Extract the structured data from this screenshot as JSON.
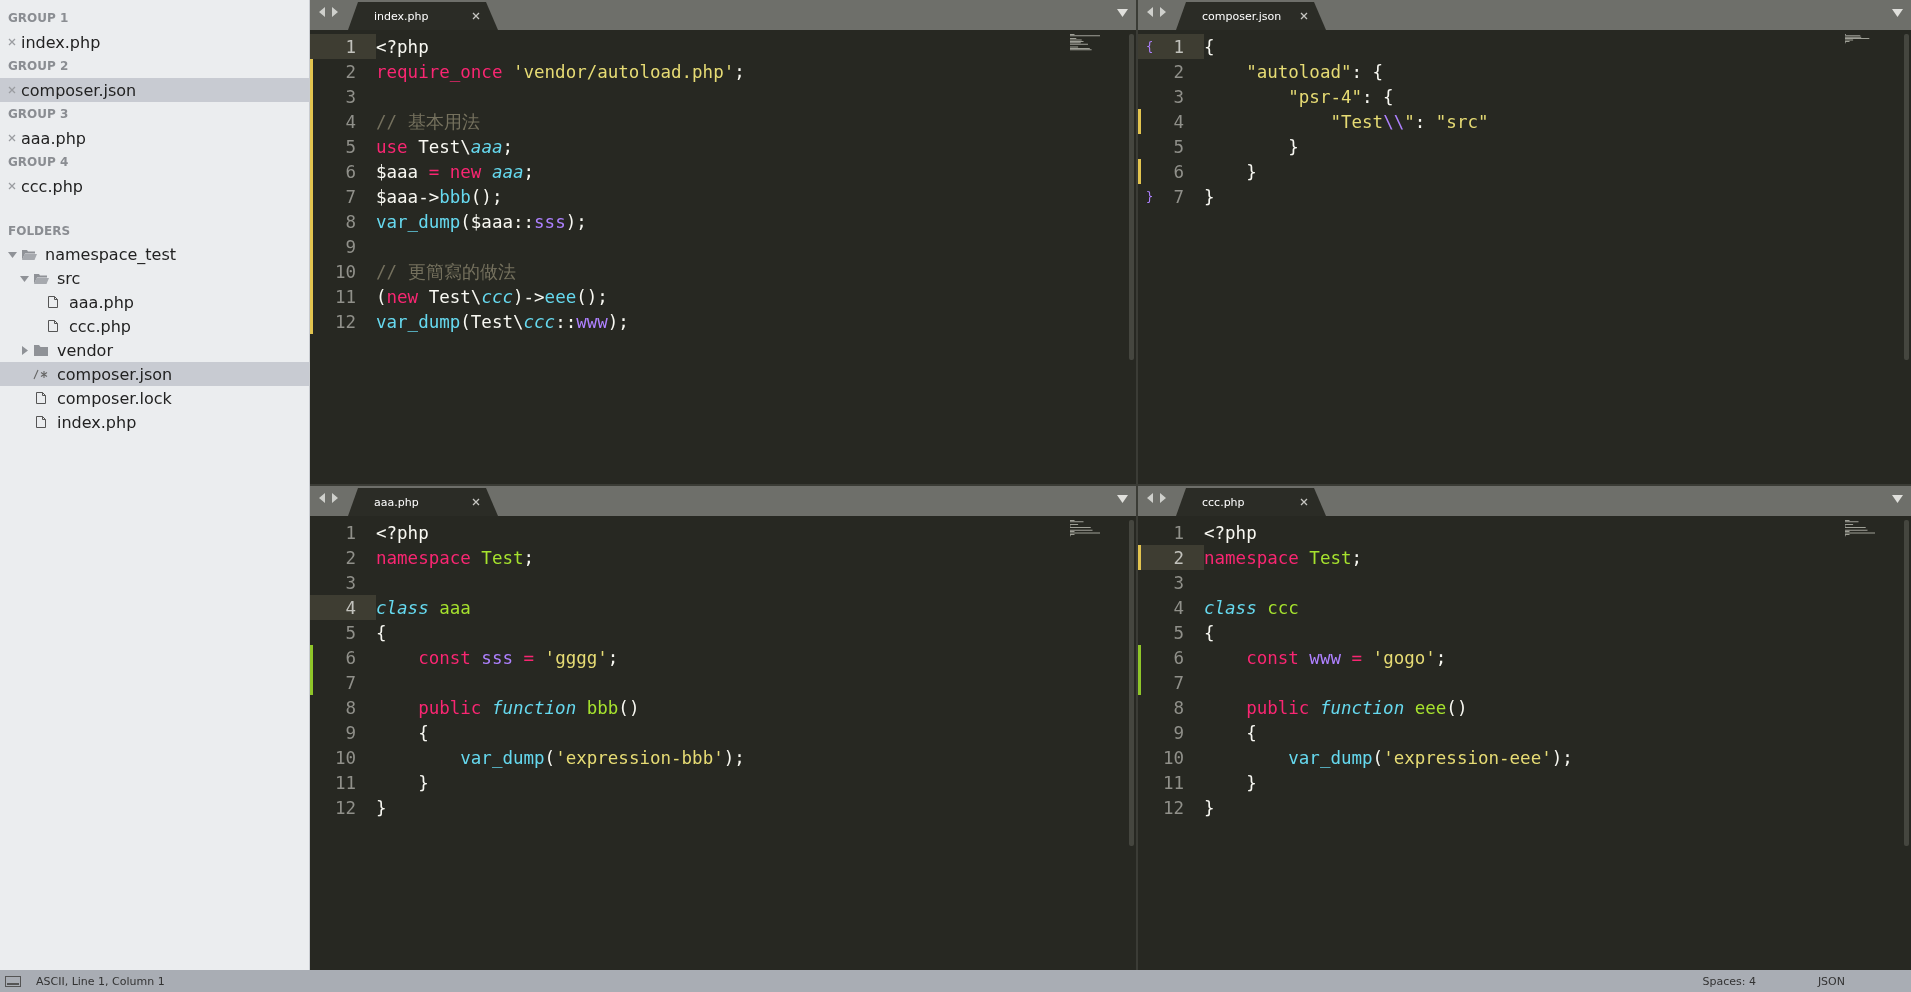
{
  "sidebar": {
    "groups": [
      {
        "title": "GROUP 1",
        "files": [
          {
            "name": "index.php",
            "selected": false
          }
        ]
      },
      {
        "title": "GROUP 2",
        "files": [
          {
            "name": "composer.json",
            "selected": true
          }
        ]
      },
      {
        "title": "GROUP 3",
        "files": [
          {
            "name": "aaa.php",
            "selected": false
          }
        ]
      },
      {
        "title": "GROUP 4",
        "files": [
          {
            "name": "ccc.php",
            "selected": false
          }
        ]
      }
    ],
    "folders_title": "FOLDERS",
    "folders": [
      {
        "name": "namespace_test",
        "kind": "folder",
        "expanded": true,
        "selected": false,
        "children": [
          {
            "name": "src",
            "kind": "folder",
            "expanded": true,
            "selected": false,
            "children": [
              {
                "name": "aaa.php",
                "kind": "file",
                "selected": false
              },
              {
                "name": "ccc.php",
                "kind": "file",
                "selected": false
              }
            ]
          },
          {
            "name": "vendor",
            "kind": "folder",
            "expanded": false,
            "selected": false
          },
          {
            "name": "composer.json",
            "kind": "json",
            "selected": true
          },
          {
            "name": "composer.lock",
            "kind": "file",
            "selected": false
          },
          {
            "name": "index.php",
            "kind": "file",
            "selected": false
          }
        ]
      }
    ]
  },
  "panes": [
    {
      "tab": {
        "title": "index.php"
      },
      "lines": [
        {
          "n": "1",
          "current": true,
          "modified": false,
          "added": false,
          "tokens": [
            {
              "t": "<?php",
              "kind": "plain"
            }
          ]
        },
        {
          "n": "2",
          "current": false,
          "modified": true,
          "added": false,
          "tokens": [
            {
              "t": "require_once ",
              "kind": "keyword"
            },
            {
              "t": "'vendor/autoload.php'",
              "kind": "string"
            },
            {
              "t": ";",
              "kind": "plain"
            }
          ]
        },
        {
          "n": "3",
          "current": false,
          "modified": true,
          "added": false
        },
        {
          "n": "4",
          "current": false,
          "modified": true,
          "added": false,
          "tokens": [
            {
              "t": "// 基本用法",
              "kind": "comment"
            }
          ]
        },
        {
          "n": "5",
          "current": false,
          "modified": true,
          "added": false,
          "tokens": [
            {
              "t": "use ",
              "kind": "keyword"
            },
            {
              "t": "Test\\",
              "kind": "plain"
            },
            {
              "t": "aaa",
              "kind": "type"
            },
            {
              "t": ";",
              "kind": "plain"
            }
          ]
        },
        {
          "n": "6",
          "current": false,
          "modified": true,
          "added": false,
          "tokens": [
            {
              "t": "$aaa ",
              "kind": "plain"
            },
            {
              "t": "= new ",
              "kind": "keyword"
            },
            {
              "t": "aaa",
              "kind": "type"
            },
            {
              "t": ";",
              "kind": "plain"
            }
          ]
        },
        {
          "n": "7",
          "current": false,
          "modified": true,
          "added": false,
          "tokens": [
            {
              "t": "$aaa->",
              "kind": "plain"
            },
            {
              "t": "bbb",
              "kind": "function"
            },
            {
              "t": "();",
              "kind": "plain"
            }
          ]
        },
        {
          "n": "8",
          "current": false,
          "modified": true,
          "added": false,
          "tokens": [
            {
              "t": "var_dump",
              "kind": "function"
            },
            {
              "t": "($aaa::",
              "kind": "plain"
            },
            {
              "t": "sss",
              "kind": "constant"
            },
            {
              "t": ");",
              "kind": "plain"
            }
          ]
        },
        {
          "n": "9",
          "current": false,
          "modified": true,
          "added": false
        },
        {
          "n": "10",
          "current": false,
          "modified": true,
          "added": false,
          "tokens": [
            {
              "t": "// 更簡寫的做法",
              "kind": "comment"
            }
          ]
        },
        {
          "n": "11",
          "current": false,
          "modified": true,
          "added": false,
          "tokens": [
            {
              "t": "(",
              "kind": "plain"
            },
            {
              "t": "new ",
              "kind": "keyword"
            },
            {
              "t": "Test\\",
              "kind": "plain"
            },
            {
              "t": "ccc",
              "kind": "type"
            },
            {
              "t": ")->",
              "kind": "plain"
            },
            {
              "t": "eee",
              "kind": "function"
            },
            {
              "t": "();",
              "kind": "plain"
            }
          ]
        },
        {
          "n": "12",
          "current": false,
          "modified": true,
          "added": false,
          "tokens": [
            {
              "t": "var_dump",
              "kind": "function"
            },
            {
              "t": "(Test\\",
              "kind": "plain"
            },
            {
              "t": "ccc",
              "kind": "type"
            },
            {
              "t": "::",
              "kind": "plain"
            },
            {
              "t": "www",
              "kind": "constant"
            },
            {
              "t": ");",
              "kind": "plain"
            }
          ]
        }
      ]
    },
    {
      "tab": {
        "title": "composer.json"
      },
      "lines": [
        {
          "n": "1",
          "current": true,
          "modified": false,
          "added": false,
          "gutter_mark": "{",
          "tokens": [
            {
              "t": "{",
              "kind": "plain"
            }
          ]
        },
        {
          "n": "2",
          "current": false,
          "modified": false,
          "added": false,
          "tokens": [
            {
              "t": "    \"autoload\"",
              "kind": "string"
            },
            {
              "t": ": {",
              "kind": "plain"
            }
          ]
        },
        {
          "n": "3",
          "current": false,
          "modified": false,
          "added": false,
          "tokens": [
            {
              "t": "        \"psr-4\"",
              "kind": "string"
            },
            {
              "t": ": {",
              "kind": "plain"
            }
          ]
        },
        {
          "n": "4",
          "current": false,
          "modified": true,
          "added": false,
          "tokens": [
            {
              "t": "            \"Test",
              "kind": "string"
            },
            {
              "t": "\\\\",
              "kind": "constant"
            },
            {
              "t": "\"",
              "kind": "string"
            },
            {
              "t": ": ",
              "kind": "plain"
            },
            {
              "t": "\"src\"",
              "kind": "string"
            }
          ]
        },
        {
          "n": "5",
          "current": false,
          "modified": false,
          "added": false,
          "tokens": [
            {
              "t": "        }",
              "kind": "plain"
            }
          ]
        },
        {
          "n": "6",
          "current": false,
          "modified": true,
          "added": false,
          "tokens": [
            {
              "t": "    }",
              "kind": "plain"
            }
          ]
        },
        {
          "n": "7",
          "current": false,
          "modified": false,
          "added": false,
          "gutter_mark": "}",
          "tokens": [
            {
              "t": "}",
              "kind": "plain"
            }
          ]
        }
      ]
    },
    {
      "tab": {
        "title": "aaa.php"
      },
      "lines": [
        {
          "n": "1",
          "current": false,
          "modified": false,
          "added": false,
          "tokens": [
            {
              "t": "<?php",
              "kind": "plain"
            }
          ]
        },
        {
          "n": "2",
          "current": false,
          "modified": false,
          "added": false,
          "tokens": [
            {
              "t": "namespace ",
              "kind": "keyword"
            },
            {
              "t": "Test",
              "kind": "name"
            },
            {
              "t": ";",
              "kind": "plain"
            }
          ]
        },
        {
          "n": "3",
          "current": false,
          "modified": false,
          "added": false
        },
        {
          "n": "4",
          "current": true,
          "modified": false,
          "added": false,
          "tokens": [
            {
              "t": "class ",
              "kind": "type"
            },
            {
              "t": "aaa",
              "kind": "name"
            }
          ]
        },
        {
          "n": "5",
          "current": false,
          "modified": false,
          "added": false,
          "tokens": [
            {
              "t": "{",
              "kind": "plain"
            }
          ]
        },
        {
          "n": "6",
          "current": false,
          "modified": false,
          "added": true,
          "tokens": [
            {
              "t": "    const ",
              "kind": "keyword"
            },
            {
              "t": "sss ",
              "kind": "constant"
            },
            {
              "t": "= ",
              "kind": "keyword"
            },
            {
              "t": "'gggg'",
              "kind": "string"
            },
            {
              "t": ";",
              "kind": "plain"
            }
          ]
        },
        {
          "n": "7",
          "current": false,
          "modified": false,
          "added": true
        },
        {
          "n": "8",
          "current": false,
          "modified": false,
          "added": false,
          "tokens": [
            {
              "t": "    public ",
              "kind": "keyword"
            },
            {
              "t": "function ",
              "kind": "type"
            },
            {
              "t": "bbb",
              "kind": "name"
            },
            {
              "t": "()",
              "kind": "plain"
            }
          ]
        },
        {
          "n": "9",
          "current": false,
          "modified": false,
          "added": false,
          "tokens": [
            {
              "t": "    {",
              "kind": "plain"
            }
          ]
        },
        {
          "n": "10",
          "current": false,
          "modified": false,
          "added": false,
          "tokens": [
            {
              "t": "        var_dump",
              "kind": "function"
            },
            {
              "t": "(",
              "kind": "plain"
            },
            {
              "t": "'expression-bbb'",
              "kind": "string"
            },
            {
              "t": ");",
              "kind": "plain"
            }
          ]
        },
        {
          "n": "11",
          "current": false,
          "modified": false,
          "added": false,
          "tokens": [
            {
              "t": "    }",
              "kind": "plain"
            }
          ]
        },
        {
          "n": "12",
          "current": false,
          "modified": false,
          "added": false,
          "tokens": [
            {
              "t": "}",
              "kind": "plain"
            }
          ]
        }
      ]
    },
    {
      "tab": {
        "title": "ccc.php"
      },
      "lines": [
        {
          "n": "1",
          "current": false,
          "modified": false,
          "added": false,
          "tokens": [
            {
              "t": "<?php",
              "kind": "plain"
            }
          ]
        },
        {
          "n": "2",
          "current": true,
          "modified": true,
          "added": false,
          "tokens": [
            {
              "t": "namespace ",
              "kind": "keyword"
            },
            {
              "t": "Test",
              "kind": "name"
            },
            {
              "t": ";",
              "kind": "plain"
            }
          ]
        },
        {
          "n": "3",
          "current": false,
          "modified": false,
          "added": false
        },
        {
          "n": "4",
          "current": false,
          "modified": false,
          "added": false,
          "tokens": [
            {
              "t": "class ",
              "kind": "type"
            },
            {
              "t": "ccc",
              "kind": "name"
            }
          ]
        },
        {
          "n": "5",
          "current": false,
          "modified": false,
          "added": false,
          "tokens": [
            {
              "t": "{",
              "kind": "plain"
            }
          ]
        },
        {
          "n": "6",
          "current": false,
          "modified": false,
          "added": true,
          "tokens": [
            {
              "t": "    const ",
              "kind": "keyword"
            },
            {
              "t": "www ",
              "kind": "constant"
            },
            {
              "t": "= ",
              "kind": "keyword"
            },
            {
              "t": "'gogo'",
              "kind": "string"
            },
            {
              "t": ";",
              "kind": "plain"
            }
          ]
        },
        {
          "n": "7",
          "current": false,
          "modified": false,
          "added": true
        },
        {
          "n": "8",
          "current": false,
          "modified": false,
          "added": false,
          "tokens": [
            {
              "t": "    public ",
              "kind": "keyword"
            },
            {
              "t": "function ",
              "kind": "type"
            },
            {
              "t": "eee",
              "kind": "name"
            },
            {
              "t": "()",
              "kind": "plain"
            }
          ]
        },
        {
          "n": "9",
          "current": false,
          "modified": false,
          "added": false,
          "tokens": [
            {
              "t": "    {",
              "kind": "plain"
            }
          ]
        },
        {
          "n": "10",
          "current": false,
          "modified": false,
          "added": false,
          "tokens": [
            {
              "t": "        var_dump",
              "kind": "function"
            },
            {
              "t": "(",
              "kind": "plain"
            },
            {
              "t": "'expression-eee'",
              "kind": "string"
            },
            {
              "t": ");",
              "kind": "plain"
            }
          ]
        },
        {
          "n": "11",
          "current": false,
          "modified": false,
          "added": false,
          "tokens": [
            {
              "t": "    }",
              "kind": "plain"
            }
          ]
        },
        {
          "n": "12",
          "current": false,
          "modified": false,
          "added": false,
          "tokens": [
            {
              "t": "}",
              "kind": "plain"
            }
          ]
        }
      ]
    }
  ],
  "status_bar": {
    "position": "ASCII, Line 1, Column 1",
    "indentation": "Spaces: 4",
    "syntax": "JSON"
  }
}
